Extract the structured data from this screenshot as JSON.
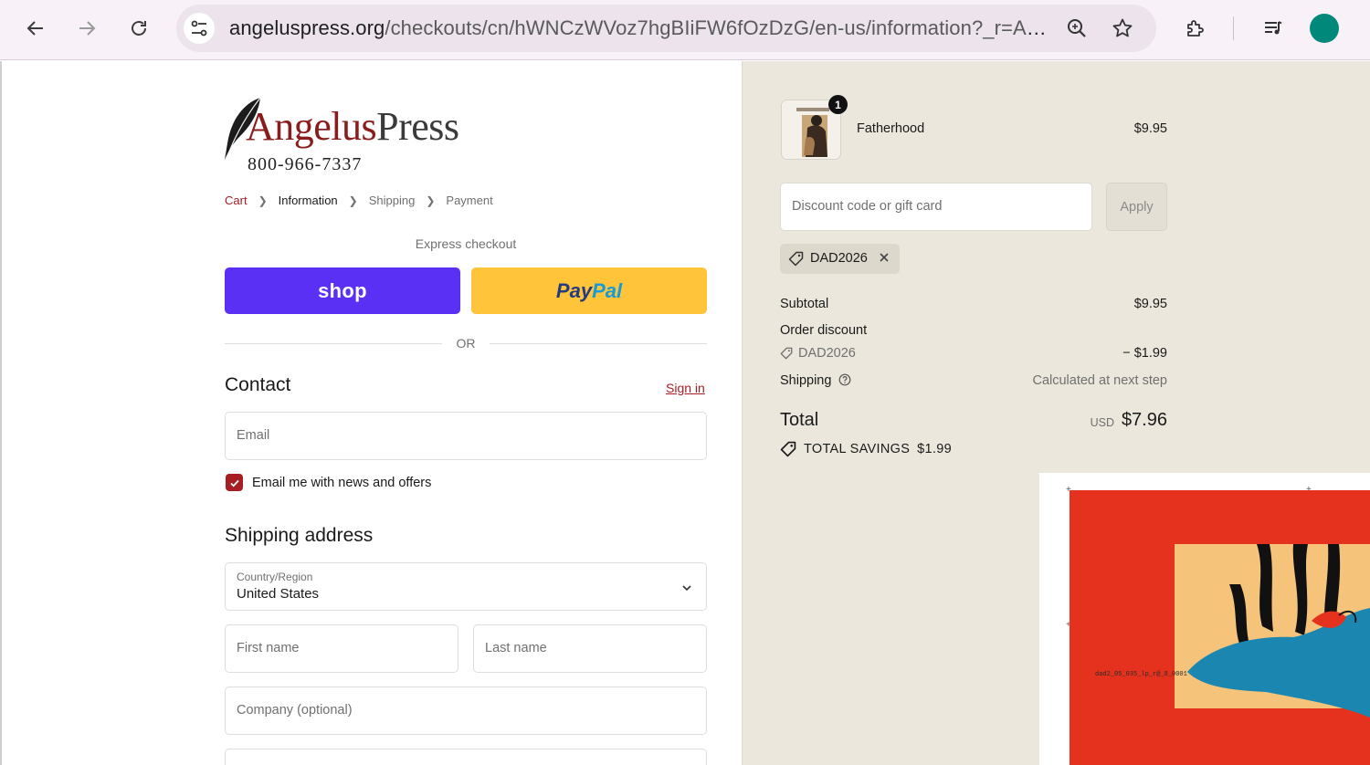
{
  "browser": {
    "url_domain": "angeluspress.org",
    "url_path": "/checkouts/cn/hWNCzWVoz7hgBIiFW6fOzDzG/en-us/information?_r=AQ..."
  },
  "store": {
    "logo_name_a": "Angelus",
    "logo_name_b": "Press",
    "phone": "800-966-7337"
  },
  "breadcrumbs": {
    "cart": "Cart",
    "information": "Information",
    "shipping": "Shipping",
    "payment": "Payment"
  },
  "express": {
    "label": "Express checkout",
    "shop_label": "shop",
    "paypal_a": "Pay",
    "paypal_b": "Pal",
    "or": "OR"
  },
  "contact": {
    "heading": "Contact",
    "sign_in": "Sign in",
    "email_placeholder": "Email",
    "newsletter_label": "Email me with news and offers",
    "newsletter_checked": true
  },
  "shipping_address": {
    "heading": "Shipping address",
    "country_label": "Country/Region",
    "country_value": "United States",
    "first_name_placeholder": "First name",
    "last_name_placeholder": "Last name",
    "company_placeholder": "Company (optional)"
  },
  "order": {
    "item": {
      "name": "Fatherhood",
      "price": "$9.95",
      "quantity": "1"
    },
    "discount_placeholder": "Discount code or gift card",
    "apply_label": "Apply",
    "applied_code": "DAD2026",
    "subtotal_label": "Subtotal",
    "subtotal_value": "$9.95",
    "order_discount_label": "Order discount",
    "discount_code": "DAD2026",
    "discount_value": "− $1.99",
    "shipping_label": "Shipping",
    "shipping_value": "Calculated at next step",
    "total_label": "Total",
    "total_currency": "USD",
    "total_value": "$7.96",
    "savings_label": "TOTAL SAVINGS",
    "savings_value": "$1.99"
  },
  "overlay": {
    "file_label": "dad2_05_035_lp_r@_8_0001"
  },
  "colors": {
    "brand_red": "#a61d24",
    "shop_purple": "#5a31f4",
    "paypal_yellow": "#ffc439",
    "summary_bg": "#ebe7dc",
    "profile": "#00897b"
  }
}
